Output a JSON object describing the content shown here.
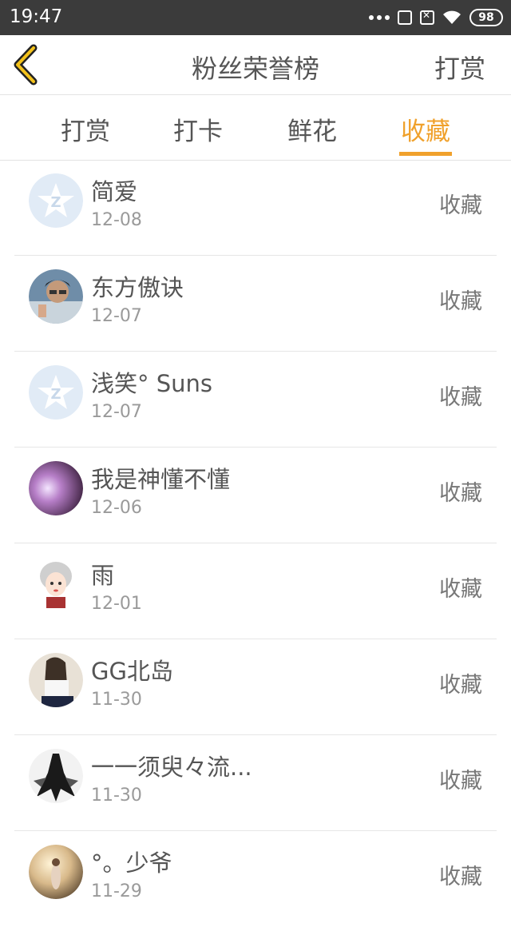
{
  "status_bar": {
    "time": "19:47",
    "battery": "98"
  },
  "header": {
    "title": "粉丝荣誉榜",
    "right_button": "打赏"
  },
  "tabs": [
    {
      "label": "打赏"
    },
    {
      "label": "打卡"
    },
    {
      "label": "鲜花"
    },
    {
      "label": "收藏"
    }
  ],
  "accent_color": "#f0a12c",
  "list": [
    {
      "name": "简爱",
      "date": "12-08",
      "action": "收藏",
      "avatar": "default-q-avatar"
    },
    {
      "name": "东方傲诀",
      "date": "12-07",
      "action": "收藏",
      "avatar": "photo-man-glasses"
    },
    {
      "name": "浅笑° Suns",
      "date": "12-07",
      "action": "收藏",
      "avatar": "default-q-avatar"
    },
    {
      "name": "我是神懂不懂",
      "date": "12-06",
      "action": "收藏",
      "avatar": "photo-purple-glow"
    },
    {
      "name": "雨",
      "date": "12-01",
      "action": "收藏",
      "avatar": "cartoon-girl"
    },
    {
      "name": "GG北岛",
      "date": "11-30",
      "action": "收藏",
      "avatar": "photo-girl"
    },
    {
      "name": "一一须臾々流...",
      "date": "11-30",
      "action": "收藏",
      "avatar": "ink-figure"
    },
    {
      "name": "°。少爷",
      "date": "11-29",
      "action": "收藏",
      "avatar": "photo-sunset"
    }
  ]
}
